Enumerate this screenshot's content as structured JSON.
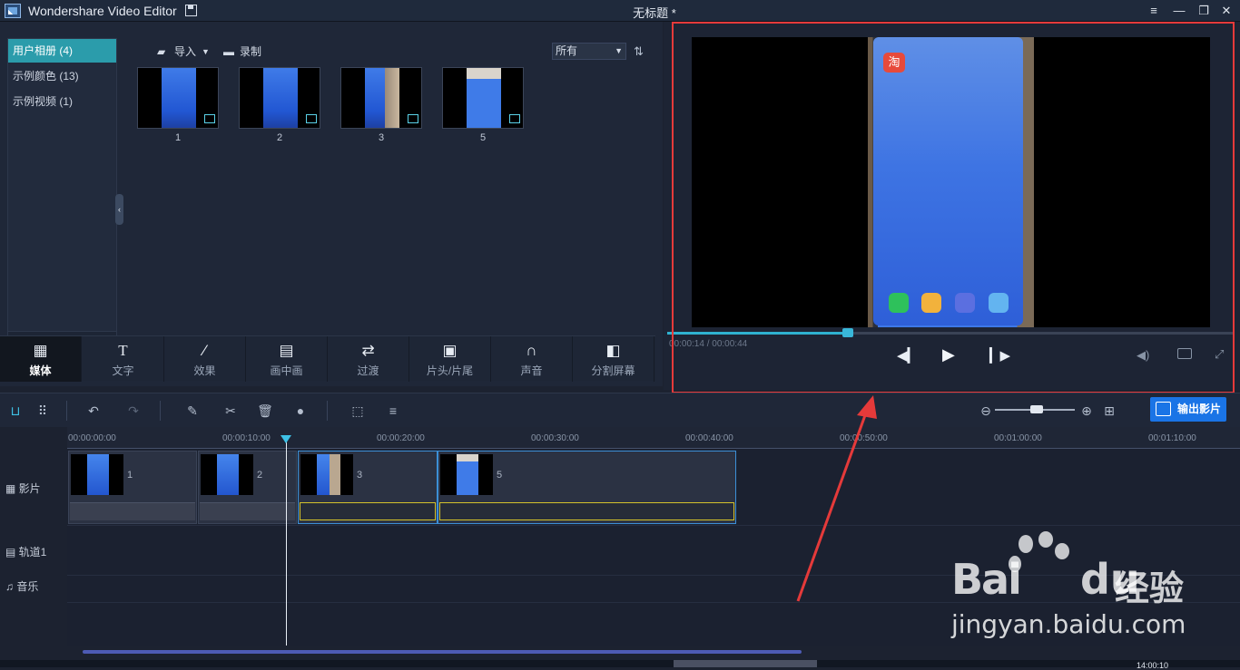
{
  "window": {
    "app_title": "Wondershare Video Editor",
    "document_title": "无标题 *",
    "buttons": [
      "≡",
      "—",
      "❐",
      "✕"
    ]
  },
  "library": {
    "albums": [
      {
        "label": "用户相册 (4)",
        "active": true
      },
      {
        "label": "示例颜色 (13)",
        "active": false
      },
      {
        "label": "示例视频 (1)",
        "active": false
      }
    ],
    "toolbar": {
      "import_label": "导入",
      "record_label": "录制"
    },
    "filter_value": "所有",
    "items": [
      {
        "label": "1",
        "icon": "video-thumbnail"
      },
      {
        "label": "2",
        "icon": "video-thumbnail"
      },
      {
        "label": "3",
        "icon": "video-thumbnail"
      },
      {
        "label": "5",
        "icon": "video-thumbnail"
      }
    ]
  },
  "tool_tabs": [
    {
      "label": "媒体",
      "icon": "film-music-icon",
      "active": true
    },
    {
      "label": "文字",
      "icon": "text-icon"
    },
    {
      "label": "效果",
      "icon": "magic-wand-icon"
    },
    {
      "label": "画中画",
      "icon": "pip-icon"
    },
    {
      "label": "过渡",
      "icon": "transition-icon"
    },
    {
      "label": "片头/片尾",
      "icon": "clapper-icon"
    },
    {
      "label": "声音",
      "icon": "headphones-icon"
    },
    {
      "label": "分割屏幕",
      "icon": "split-screen-icon"
    }
  ],
  "preview": {
    "time": "00:00:14 / 00:00:44",
    "progress": 0.318,
    "phone_app_label": "淘"
  },
  "timeline": {
    "export_label": "输出影片",
    "zoom_level": 0.52,
    "ruler_labels": [
      "00:00:00:00",
      "00:00:10:00",
      "00:00:20:00",
      "00:00:30:00",
      "00:00:40:00",
      "00:00:50:00",
      "00:01:00:00",
      "00:01:10:00"
    ],
    "tracks": [
      "影片",
      "轨道1",
      "音乐"
    ],
    "clips": [
      {
        "label": "1",
        "selected": false
      },
      {
        "label": "2",
        "selected": false
      },
      {
        "label": "3",
        "selected": true
      },
      {
        "label": "5",
        "selected": true
      }
    ]
  },
  "watermark": {
    "brand_bai": "Bai",
    "brand_du": "du",
    "brand_cn": "经验",
    "url": "jingyan.baidu.com"
  },
  "corner_time": "14:00:10",
  "colors": {
    "accent": "#2b9cab",
    "export_button": "#1a74e6",
    "highlight_box": "#e53a3a",
    "playhead": "#3ec1e6"
  }
}
